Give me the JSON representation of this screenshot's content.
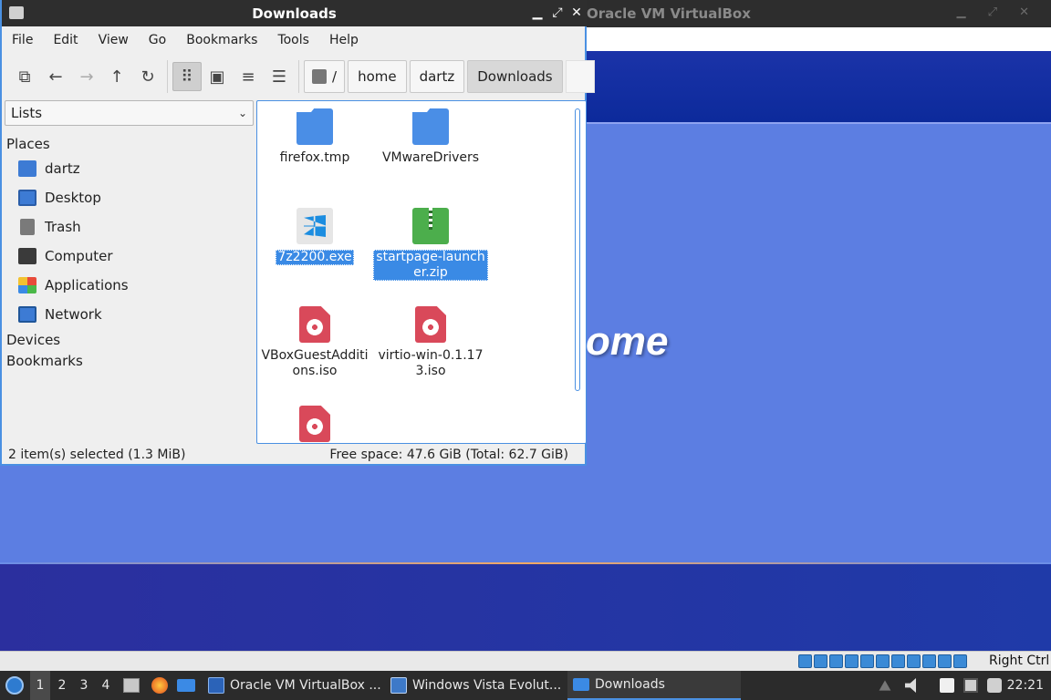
{
  "vbox": {
    "title": "Oracle VM VirtualBox",
    "welcome_text": "ome",
    "host_key": "Right Ctrl"
  },
  "file_manager": {
    "title": "Downloads",
    "menu": [
      "File",
      "Edit",
      "View",
      "Go",
      "Bookmarks",
      "Tools",
      "Help"
    ],
    "toolbar_icons": [
      "new-tab-icon",
      "back-arrow-icon",
      "forward-arrow-icon",
      "up-arrow-icon",
      "reload-icon",
      "icon-view-icon",
      "thumbnail-view-icon",
      "compact-view-icon",
      "detailed-list-icon"
    ],
    "path": {
      "root": "/",
      "segments": [
        "home",
        "dartz",
        "Downloads"
      ]
    },
    "sidebar": {
      "mode": "Lists",
      "places_heading": "Places",
      "places": [
        "dartz",
        "Desktop",
        "Trash",
        "Computer",
        "Applications",
        "Network"
      ],
      "devices_heading": "Devices",
      "bookmarks_heading": "Bookmarks"
    },
    "files": [
      {
        "name": "firefox.tmp",
        "type": "folder",
        "selected": false
      },
      {
        "name": "VMwareDrivers",
        "type": "folder",
        "selected": false
      },
      {
        "name": "7z2200.exe",
        "type": "exe",
        "selected": true
      },
      {
        "name": "startpage-launcher.zip",
        "type": "zip",
        "selected": true
      },
      {
        "name": "VBoxGuestAdditions.iso",
        "type": "iso",
        "selected": false
      },
      {
        "name": "virtio-win-0.1.173.iso",
        "type": "iso",
        "selected": false
      },
      {
        "name": "",
        "type": "iso",
        "selected": false
      }
    ],
    "status": {
      "selection": "2 item(s) selected (1.3 MiB)",
      "free_space": "Free space: 47.6 GiB (Total: 62.7 GiB)"
    }
  },
  "taskbar": {
    "workspaces": [
      "1",
      "2",
      "3",
      "4"
    ],
    "tasks": [
      "Oracle VM VirtualBox ...",
      "Windows Vista Evolut...",
      "Downloads"
    ],
    "clock": "22:21"
  },
  "colors": {
    "selection": "#3a8ae5",
    "accent_border": "#4a90e2",
    "desktop_blue": "#5c7ee2"
  }
}
